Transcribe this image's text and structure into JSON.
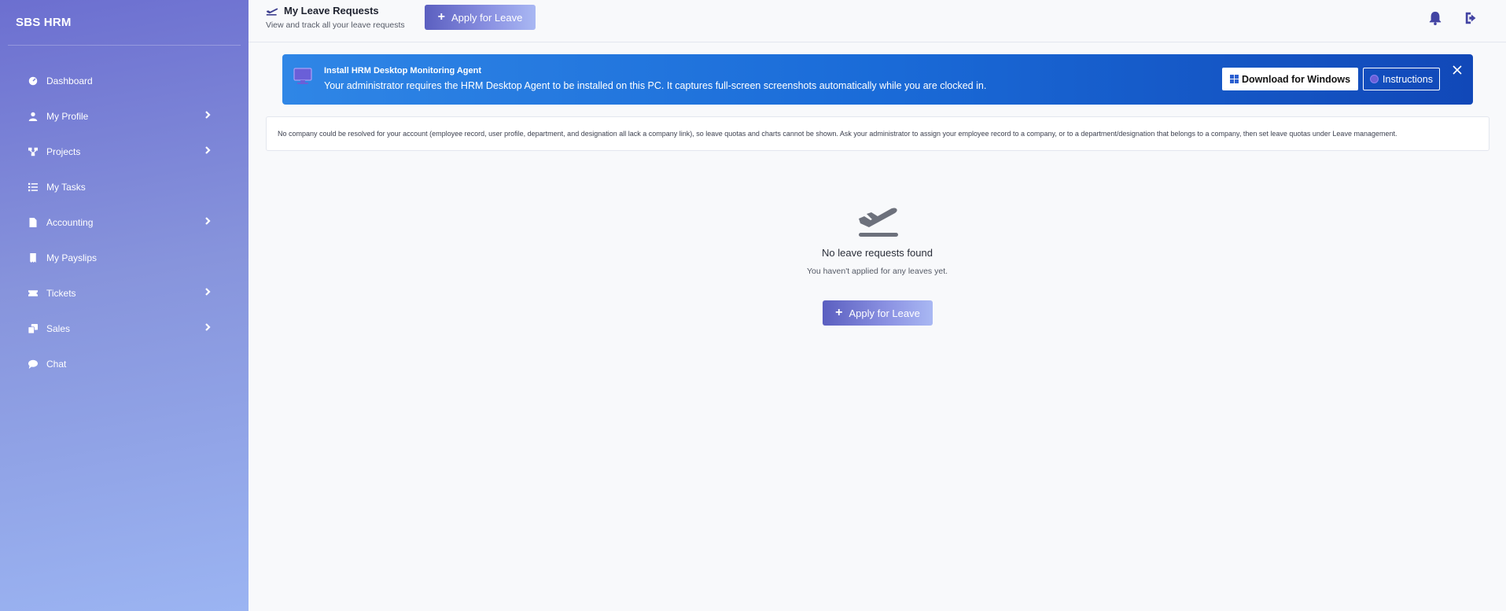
{
  "app": {
    "brand": "SBS HRM"
  },
  "sidebar": {
    "items": [
      {
        "label": "Dashboard",
        "icon": "dashboard-icon",
        "has_submenu": false
      },
      {
        "label": "My Profile",
        "icon": "user-icon",
        "has_submenu": true
      },
      {
        "label": "Projects",
        "icon": "projects-icon",
        "has_submenu": true
      },
      {
        "label": "My Tasks",
        "icon": "tasks-icon",
        "has_submenu": false
      },
      {
        "label": "Accounting",
        "icon": "document-icon",
        "has_submenu": true
      },
      {
        "label": "My Payslips",
        "icon": "receipt-icon",
        "has_submenu": false
      },
      {
        "label": "Tickets",
        "icon": "ticket-icon",
        "has_submenu": true
      },
      {
        "label": "Sales",
        "icon": "sales-icon",
        "has_submenu": true
      },
      {
        "label": "Chat",
        "icon": "chat-icon",
        "has_submenu": false
      }
    ]
  },
  "header": {
    "title": "My Leave Requests",
    "subtitle": "View and track all your leave requests",
    "apply_label": "Apply for Leave",
    "title_icon": "plane-departure-icon",
    "notifications_icon": "bell-icon",
    "logout_icon": "logout-icon"
  },
  "banner": {
    "title": "Install HRM Desktop Monitoring Agent",
    "text": "Your administrator requires the HRM Desktop Agent to be installed on this PC. It captures full-screen screenshots automatically while you are clocked in.",
    "download_label": "Download for Windows",
    "instructions_label": "Instructions",
    "close_icon": "close-icon"
  },
  "notice": {
    "text": "No company could be resolved for your account (employee record, user profile, department, and designation all lack a company link), so leave quotas and charts cannot be shown. Ask your administrator to assign your employee record to a company, or to a department/designation that belongs to a company, then set leave quotas under Leave management."
  },
  "empty_state": {
    "title": "No leave requests found",
    "subtitle": "You haven't applied for any leaves yet.",
    "apply_label": "Apply for Leave",
    "icon": "plane-departure-icon"
  },
  "colors": {
    "accent": "#4344a3",
    "banner_blue": "#1a6bd8",
    "sidebar_top": "#6c6fd0",
    "sidebar_bottom": "#9bb4f2"
  }
}
